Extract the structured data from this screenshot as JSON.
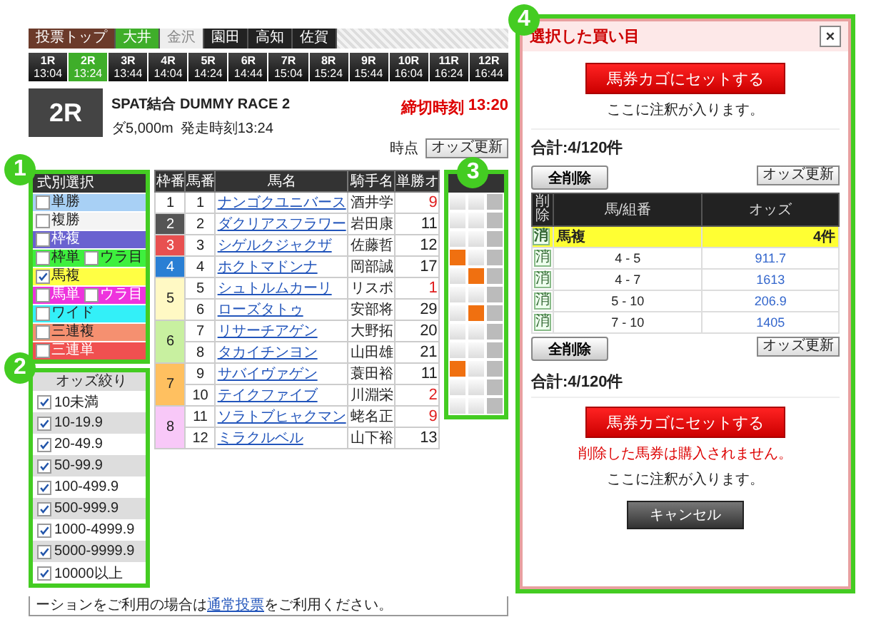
{
  "callouts": [
    {
      "label": "1"
    },
    {
      "label": "2"
    },
    {
      "label": "3"
    },
    {
      "label": "4"
    }
  ],
  "venue_tabs": [
    {
      "label": "投票トップ",
      "kind": "home",
      "selected": false
    },
    {
      "label": "大井",
      "kind": "venue",
      "selected": true
    },
    {
      "label": "金沢",
      "kind": "closed",
      "selected": false
    },
    {
      "label": "園田",
      "kind": "venue",
      "selected": false
    },
    {
      "label": "高知",
      "kind": "venue",
      "selected": false
    },
    {
      "label": "佐賀",
      "kind": "venue",
      "selected": false
    }
  ],
  "race_tabs": [
    {
      "race": "1R",
      "time": "13:04",
      "selected": false
    },
    {
      "race": "2R",
      "time": "13:24",
      "selected": true
    },
    {
      "race": "3R",
      "time": "13:44",
      "selected": false
    },
    {
      "race": "4R",
      "time": "14:04",
      "selected": false
    },
    {
      "race": "5R",
      "time": "14:24",
      "selected": false
    },
    {
      "race": "6R",
      "time": "14:44",
      "selected": false
    },
    {
      "race": "7R",
      "time": "15:04",
      "selected": false
    },
    {
      "race": "8R",
      "time": "15:24",
      "selected": false
    },
    {
      "race": "9R",
      "time": "15:44",
      "selected": false
    },
    {
      "race": "10R",
      "time": "16:04",
      "selected": false
    },
    {
      "race": "11R",
      "time": "16:24",
      "selected": false
    },
    {
      "race": "12R",
      "time": "16:44",
      "selected": false
    }
  ],
  "race": {
    "number": "2R",
    "name": "SPAT結合 DUMMY RACE 2",
    "distance": "ダ5,000m",
    "start": "発走時刻13:24",
    "deadline_label": "締切時刻",
    "deadline_time": "13:20"
  },
  "odds_time": {
    "label": "時点",
    "button": "オッズ更新"
  },
  "bet_types": {
    "title": "式別選択",
    "items": [
      {
        "kind": "single",
        "label": "単勝",
        "checked": false,
        "color": "#a8d0f5"
      },
      {
        "kind": "single",
        "label": "複勝",
        "checked": false,
        "color": "#f4f4f4"
      },
      {
        "kind": "single",
        "label": "枠複",
        "checked": false,
        "color": "#6a62d0"
      },
      {
        "kind": "pair",
        "label": "枠単",
        "checked": false,
        "color": "#3ef03e",
        "reverse": {
          "label": "ウラ目",
          "checked": false
        }
      },
      {
        "kind": "single",
        "label": "馬複",
        "checked": true,
        "color": "#ffff44"
      },
      {
        "kind": "pair",
        "label": "馬単",
        "checked": false,
        "color": "#ee33dd",
        "reverse": {
          "label": "ウラ目",
          "checked": false
        }
      },
      {
        "kind": "single",
        "label": "ワイド",
        "checked": false,
        "color": "#33f0f8"
      },
      {
        "kind": "single",
        "label": "三連複",
        "checked": false,
        "color": "#f59070"
      },
      {
        "kind": "single",
        "label": "三連単",
        "checked": false,
        "color": "#f05050"
      }
    ]
  },
  "odds_filter": {
    "title": "オッズ絞り",
    "items": [
      {
        "label": "10未満",
        "checked": true
      },
      {
        "label": "10-19.9",
        "checked": true
      },
      {
        "label": "20-49.9",
        "checked": true
      },
      {
        "label": "50-99.9",
        "checked": true
      },
      {
        "label": "100-499.9",
        "checked": true
      },
      {
        "label": "500-999.9",
        "checked": true
      },
      {
        "label": "1000-4999.9",
        "checked": true
      },
      {
        "label": "5000-9999.9",
        "checked": true
      },
      {
        "label": "10000以上",
        "checked": true
      }
    ]
  },
  "horse_table": {
    "columns": [
      "枠番",
      "馬番",
      "馬名",
      "騎手名",
      "単勝オ"
    ],
    "frames": [
      {
        "frame": "1",
        "color": "#ffffff",
        "horses": [
          {
            "no": "1",
            "name": "ナンゴクユニバース",
            "jockey": "酒井学",
            "odds": "9",
            "hot": true,
            "picks": [
              false,
              false,
              false
            ]
          }
        ]
      },
      {
        "frame": "2",
        "color": "#555555",
        "horses": [
          {
            "no": "2",
            "name": "ダクリアスフラワー",
            "jockey": "岩田康",
            "odds": "11",
            "hot": false,
            "picks": [
              false,
              false,
              false
            ]
          }
        ]
      },
      {
        "frame": "3",
        "color": "#e85050",
        "horses": [
          {
            "no": "3",
            "name": "シゲルクジャクザ",
            "jockey": "佐藤哲",
            "odds": "12",
            "hot": false,
            "picks": [
              false,
              false,
              false
            ]
          }
        ]
      },
      {
        "frame": "4",
        "color": "#2a7fd4",
        "horses": [
          {
            "no": "4",
            "name": "ホクトマドンナ",
            "jockey": "岡部誠",
            "odds": "17",
            "hot": false,
            "picks": [
              true,
              false,
              false
            ]
          }
        ]
      },
      {
        "frame": "5",
        "color": "#fff9c4",
        "horses": [
          {
            "no": "5",
            "name": "シュトルムカーリ",
            "jockey": "リスポ",
            "odds": "1",
            "hot": true,
            "picks": [
              false,
              true,
              false
            ]
          },
          {
            "no": "6",
            "name": "ローズタトゥ",
            "jockey": "安部将",
            "odds": "29",
            "hot": false,
            "picks": [
              false,
              false,
              false
            ]
          }
        ]
      },
      {
        "frame": "6",
        "color": "#c8f0a0",
        "horses": [
          {
            "no": "7",
            "name": "リサーチアゲン",
            "jockey": "大野拓",
            "odds": "20",
            "hot": false,
            "picks": [
              false,
              true,
              false
            ]
          },
          {
            "no": "8",
            "name": "タカイチンヨン",
            "jockey": "山田雄",
            "odds": "21",
            "hot": false,
            "picks": [
              false,
              false,
              false
            ]
          }
        ]
      },
      {
        "frame": "7",
        "color": "#ffc060",
        "horses": [
          {
            "no": "9",
            "name": "サバイヴァゲン",
            "jockey": "蓑田裕",
            "odds": "11",
            "hot": false,
            "picks": [
              false,
              false,
              false
            ]
          },
          {
            "no": "10",
            "name": "テイクファイブ",
            "jockey": "川淵栄",
            "odds": "2",
            "hot": true,
            "picks": [
              true,
              false,
              false
            ]
          }
        ]
      },
      {
        "frame": "8",
        "color": "#f8c8f8",
        "horses": [
          {
            "no": "11",
            "name": "ソラトブヒャクマン",
            "jockey": "蛯名正",
            "odds": "9",
            "hot": true,
            "picks": [
              false,
              false,
              false
            ]
          },
          {
            "no": "12",
            "name": "ミラクルベル",
            "jockey": "山下裕",
            "odds": "13",
            "hot": false,
            "picks": [
              false,
              false,
              false
            ]
          }
        ]
      }
    ]
  },
  "footer": {
    "before": "ーションをご利用の場合は",
    "link": "通常投票",
    "after": "をご利用ください。"
  },
  "panel": {
    "title": "選択した買い目",
    "close": "×",
    "set_button": "馬券カゴにセットする",
    "note": "ここに注釈が入ります。",
    "total": "合計:4/120件",
    "clear_button": "全削除",
    "refresh_button": "オッズ更新",
    "columns": [
      "削除",
      "馬/組番",
      "オッズ"
    ],
    "groups": [
      {
        "delete": "消",
        "label": "馬複",
        "count": "4件",
        "rows": [
          {
            "delete": "消",
            "combo": "4 - 5",
            "odds": "911.7"
          },
          {
            "delete": "消",
            "combo": "4 - 7",
            "odds": "1613"
          },
          {
            "delete": "消",
            "combo": "5 - 10",
            "odds": "206.9"
          },
          {
            "delete": "消",
            "combo": "7 - 10",
            "odds": "1405"
          }
        ]
      }
    ],
    "bottom": {
      "clear_button": "全削除",
      "refresh_button": "オッズ更新",
      "total": "合計:4/120件",
      "set_button": "馬券カゴにセットする",
      "warning": "削除した馬券は購入されません。",
      "note": "ここに注釈が入ります。",
      "cancel_button": "キャンセル"
    }
  }
}
